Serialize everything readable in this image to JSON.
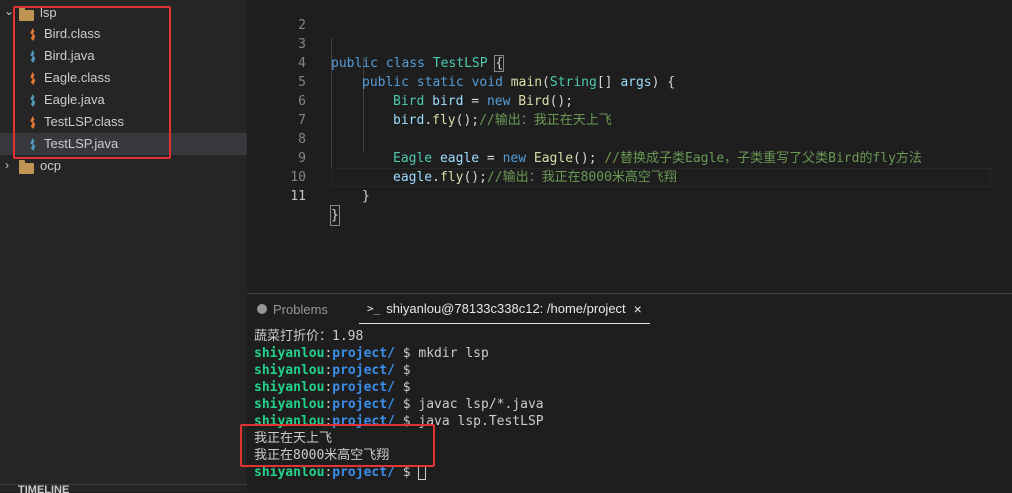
{
  "explorer": {
    "root_folder": "lsp",
    "files": [
      {
        "name": "Bird.class",
        "type": "class"
      },
      {
        "name": "Bird.java",
        "type": "java"
      },
      {
        "name": "Eagle.class",
        "type": "class"
      },
      {
        "name": "Eagle.java",
        "type": "java"
      },
      {
        "name": "TestLSP.class",
        "type": "class"
      },
      {
        "name": "TestLSP.java",
        "type": "java"
      }
    ],
    "other_folder": "ocp",
    "timeline_label": "TIMELINE"
  },
  "editor": {
    "line_numbers": [
      "2",
      "3",
      "4",
      "5",
      "6",
      "7",
      "8",
      "9",
      "10",
      "11"
    ],
    "code": {
      "l3_kw1": "public",
      "l3_kw2": "class",
      "l3_name": "TestLSP",
      "l3_brace": "{",
      "l4_kw1": "public",
      "l4_kw2": "static",
      "l4_kw3": "void",
      "l4_fn": "main",
      "l4_p1": "(",
      "l4_type": "String",
      "l4_p2": "[] ",
      "l4_var": "args",
      "l4_p3": ") {",
      "l5_type": "Bird",
      "l5_var": "bird",
      "l5_eq": " = ",
      "l5_new": "new",
      "l5_ctor": "Bird",
      "l5_end": "();",
      "l6_var": "bird",
      "l6_dot": ".",
      "l6_fn": "fly",
      "l6_end": "();",
      "l6_cm": "//输出：我正在天上飞",
      "l8_type": "Eagle",
      "l8_var": "eagle",
      "l8_eq": " = ",
      "l8_new": "new",
      "l8_ctor": "Eagle",
      "l8_end": "(); ",
      "l8_cm": "//替换成子类Eagle，子类重写了父类Bird的fly方法",
      "l9_var": "eagle",
      "l9_dot": ".",
      "l9_fn": "fly",
      "l9_end": "();",
      "l9_cm": "//输出：我正在8000米高空飞翔",
      "l10": "}",
      "l11": "}"
    }
  },
  "panel": {
    "tab_problems": "Problems",
    "tab_terminal": "shiyanlou@78133c338c12: /home/project",
    "close_glyph": "×",
    "terminal": {
      "line1": "蔬菜打折价：1.98",
      "user": "shiyanlou",
      "colon": ":",
      "path": "project/",
      "prompt": " $ ",
      "cmd_mkdir": "mkdir lsp",
      "cmd_empty": "",
      "cmd_javac": "javac lsp/*.java",
      "cmd_java": "java lsp.TestLSP",
      "out1": "我正在天上飞",
      "out2": "我正在8000米高空飞翔"
    }
  }
}
